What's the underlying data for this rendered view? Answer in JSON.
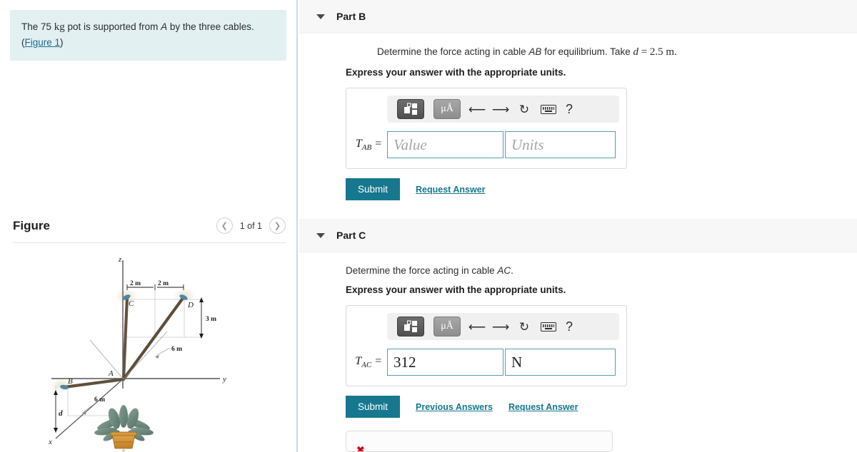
{
  "left": {
    "problem": {
      "prefix": "The 75 ",
      "unit": "kg",
      "mid": " pot is supported from ",
      "point": "A",
      "suffix": " by the three cables.",
      "figure_link": "Figure 1",
      "paren_open": "(",
      "paren_close": ")"
    },
    "figure": {
      "title": "Figure",
      "count": "1 of 1",
      "prev_icon": "chevron-left-icon",
      "next_icon": "chevron-right-icon",
      "labels": {
        "z_axis": "z",
        "y_axis": "y",
        "x_axis": "x",
        "point_a": "A",
        "point_b": "B",
        "point_c": "C",
        "point_d": "D",
        "dim_cd_left": "2 m",
        "dim_cd_right": "2 m",
        "dim_height": "3 m",
        "dim_y": "6 m",
        "dim_x": "6 m",
        "dim_d": "d"
      }
    }
  },
  "parts": [
    {
      "id": "b",
      "header": "Part B",
      "caret_icon": "caret-down-icon",
      "question_pre": "Determine the force acting in cable ",
      "question_cable": "AB",
      "question_mid": " for equilibrium. Take ",
      "question_var": "d",
      "question_eq": " = ",
      "question_val": "2.5 m.",
      "question_indented": true,
      "express": "Express your answer with the appropriate units.",
      "toolbar": {
        "template_icon": "math-template-icon",
        "units_icon": "μÅ",
        "undo_icon": "undo-arrow-icon",
        "redo_icon": "redo-arrow-icon",
        "reset_icon": "reset-circular-arrow-icon",
        "keyboard_icon": "keyboard-icon",
        "help_icon": "?"
      },
      "var_name": "T",
      "var_sub": "AB",
      "var_eq": " =",
      "value": "",
      "value_placeholder": "Value",
      "units": "",
      "units_placeholder": "Units",
      "submit_label": "Submit",
      "links": [
        "Request Answer"
      ],
      "has_feedback": false
    },
    {
      "id": "c",
      "header": "Part C",
      "caret_icon": "caret-down-icon",
      "question_pre": "Determine the force acting in cable ",
      "question_cable": "AC",
      "question_mid": ".",
      "question_var": "",
      "question_eq": "",
      "question_val": "",
      "question_indented": false,
      "express": "Express your answer with the appropriate units.",
      "toolbar": {
        "template_icon": "math-template-icon",
        "units_icon": "μÅ",
        "undo_icon": "undo-arrow-icon",
        "redo_icon": "redo-arrow-icon",
        "reset_icon": "reset-circular-arrow-icon",
        "keyboard_icon": "keyboard-icon",
        "help_icon": "?"
      },
      "var_name": "T",
      "var_sub": "AC",
      "var_eq": " =",
      "value": "312",
      "value_placeholder": "Value",
      "units": "N",
      "units_placeholder": "Units",
      "submit_label": "Submit",
      "links": [
        "Previous Answers",
        "Request Answer"
      ],
      "has_feedback": true,
      "feedback_icon": "error-x-icon"
    }
  ],
  "colors": {
    "accent": "#15788e",
    "problem_bg": "#e2f0f1",
    "header_bg": "#f7f7f7",
    "field_border": "#5a9cb4",
    "divider": "#c9d9ea",
    "error": "#d0021b"
  }
}
